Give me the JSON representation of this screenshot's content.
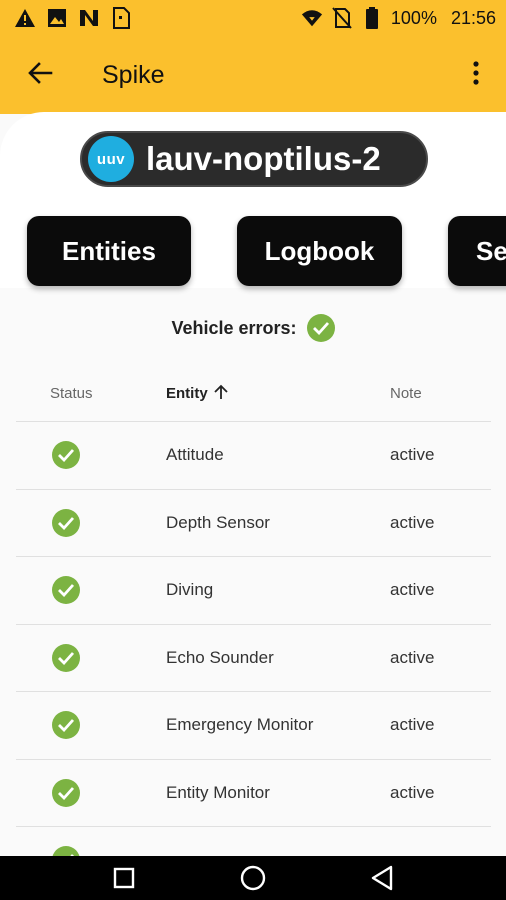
{
  "status_bar": {
    "battery": "100%",
    "time": "21:56",
    "left_icons": [
      "warning-icon",
      "image-icon",
      "n-icon",
      "sim-icon"
    ],
    "right_icons": [
      "wifi-icon",
      "no-sim-icon",
      "battery-icon"
    ]
  },
  "app_bar": {
    "title": "Spike",
    "back_icon": "arrow-back-icon",
    "menu_icon": "more-vert-icon"
  },
  "vehicle": {
    "badge": "uuv",
    "name": "lauv-noptilus-2"
  },
  "nav_buttons": {
    "entities": "Entities",
    "logbook": "Logbook",
    "more": "Se"
  },
  "vehicle_errors": {
    "label": "Vehicle errors:",
    "status_icon": "check-circle-icon"
  },
  "table": {
    "headers": {
      "status": "Status",
      "entity": "Entity",
      "note": "Note",
      "sort_icon": "arrow-up-icon"
    },
    "rows": [
      {
        "entity": "Attitude",
        "note": "active"
      },
      {
        "entity": "Depth Sensor",
        "note": "active"
      },
      {
        "entity": "Diving",
        "note": "active"
      },
      {
        "entity": "Echo Sounder",
        "note": "active"
      },
      {
        "entity": "Emergency Monitor",
        "note": "active"
      },
      {
        "entity": "Entity Monitor",
        "note": "active"
      }
    ]
  },
  "colors": {
    "app_bar": "#fbc02d",
    "ok_green": "#7cb342",
    "uuv_badge": "#1faee0",
    "pill": "#2b2b2b"
  },
  "system_nav": [
    "recents-icon",
    "home-icon",
    "back-triangle-icon"
  ]
}
